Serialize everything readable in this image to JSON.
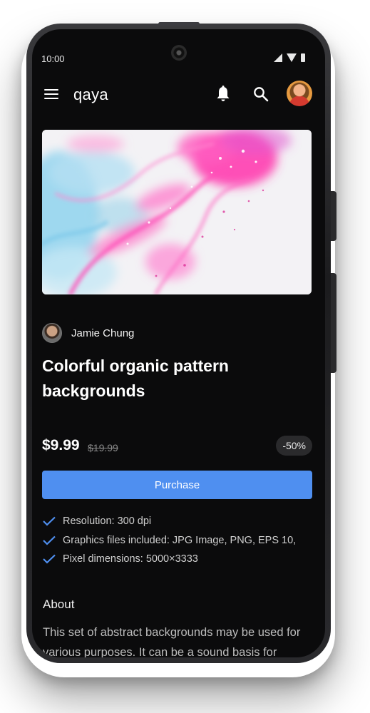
{
  "status_bar": {
    "time": "10:00"
  },
  "app_bar": {
    "title": "qaya"
  },
  "product": {
    "author": "Jamie Chung",
    "title": "Colorful organic pattern backgrounds",
    "price": "$9.99",
    "original_price": "$19.99",
    "discount": "-50%",
    "purchase_label": "Purchase",
    "features": [
      "Resolution: 300 dpi",
      "Graphics files included: JPG Image, PNG, EPS 10,",
      "Pixel dimensions: 5000×3333"
    ],
    "about_heading": "About",
    "about_text": "This set of abstract backgrounds may be used for various purposes. It can be a sound basis for"
  },
  "colors": {
    "screen_bg": "#0b0b0c",
    "accent": "#4f8ff0",
    "check": "#4f8ff0",
    "chip_bg": "#2a2a2c"
  },
  "icons": [
    "menu-icon",
    "bell-icon",
    "search-icon",
    "check-icon"
  ]
}
